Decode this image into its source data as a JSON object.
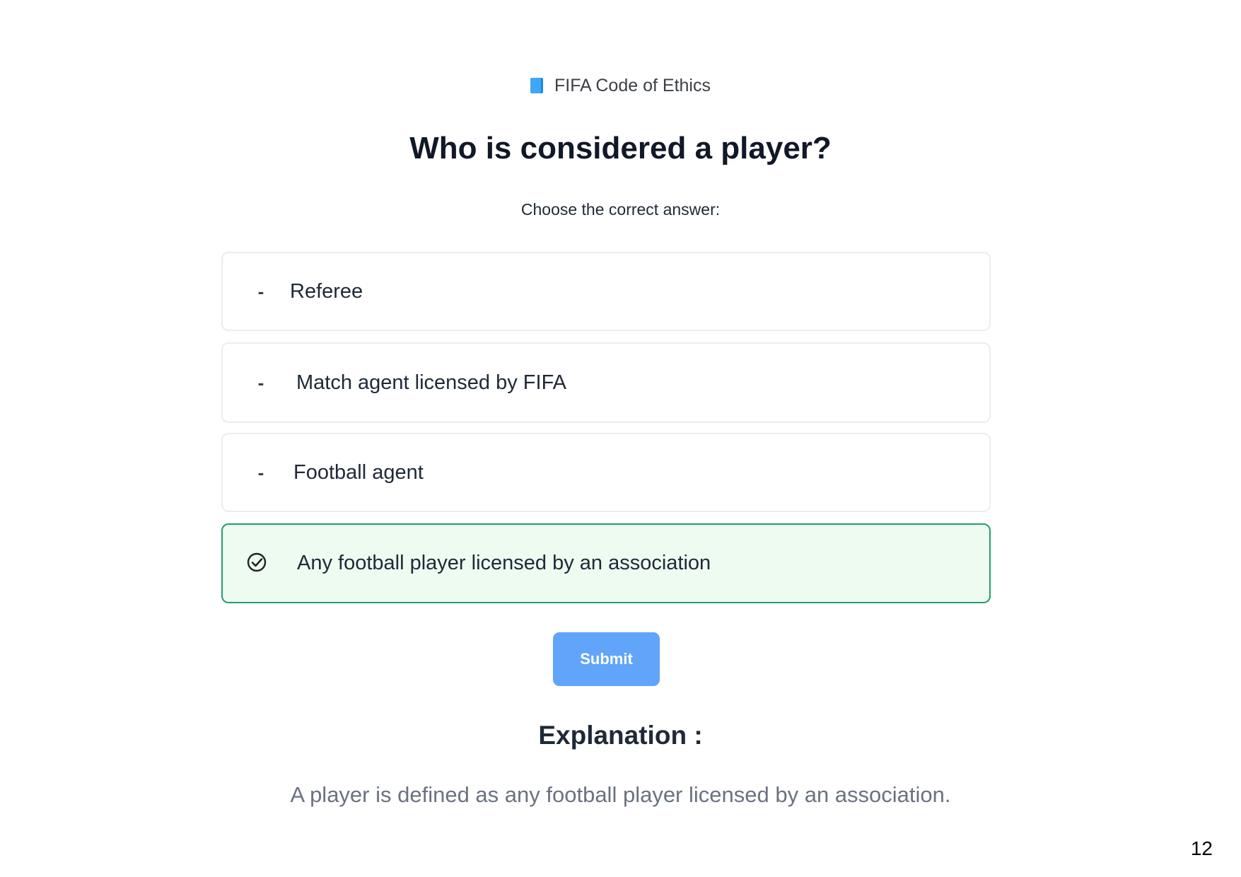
{
  "header": {
    "category_icon": "book-icon",
    "category": "FIFA Code of Ethics"
  },
  "question": {
    "title": "Who is considered a player?",
    "instruction": "Choose the correct answer:"
  },
  "options": [
    {
      "marker": "-",
      "label": "Referee",
      "selected": false
    },
    {
      "marker": "-",
      "label": "Match agent licensed by FIFA",
      "selected": false
    },
    {
      "marker": "-",
      "label": "Football agent",
      "selected": false
    },
    {
      "marker": "check-circle-icon",
      "label": "Any football player licensed by an association",
      "selected": true
    }
  ],
  "actions": {
    "submit_label": "Submit"
  },
  "explanation": {
    "title": "Explanation :",
    "text": "A player is defined as any football player licensed by an association."
  },
  "page": {
    "number": "12"
  },
  "colors": {
    "accent": "#60a5fa",
    "correct_border": "#22a06b",
    "correct_background": "#edfbf1"
  }
}
